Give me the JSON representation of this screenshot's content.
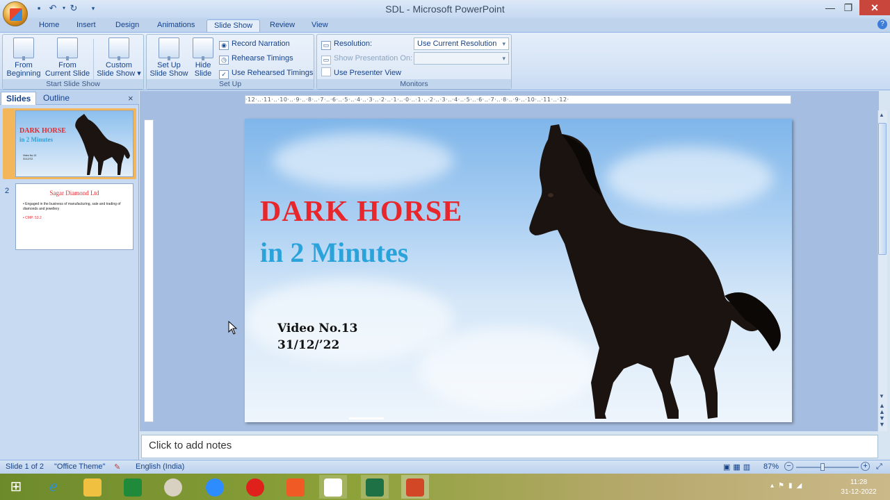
{
  "window": {
    "title": "SDL - Microsoft PowerPoint"
  },
  "qat": {
    "save": "save-icon",
    "undo": "undo-icon",
    "redo": "redo-icon"
  },
  "tabs": [
    "Home",
    "Insert",
    "Design",
    "Animations",
    "Slide Show",
    "Review",
    "View"
  ],
  "active_tab": "Slide Show",
  "ribbon": {
    "start_group": {
      "label": "Start Slide Show",
      "from_beginning": [
        "From",
        "Beginning"
      ],
      "from_current": [
        "From",
        "Current Slide"
      ],
      "custom": [
        "Custom",
        "Slide Show"
      ]
    },
    "setup_group": {
      "label": "Set Up",
      "setup_show": [
        "Set Up",
        "Slide Show"
      ],
      "hide_slide": [
        "Hide",
        "Slide"
      ],
      "record_narration": "Record Narration",
      "rehearse_timings": "Rehearse Timings",
      "use_rehearsed": "Use Rehearsed Timings",
      "use_rehearsed_checked": true
    },
    "monitors_group": {
      "label": "Monitors",
      "resolution_label": "Resolution:",
      "resolution_value": "Use Current Resolution",
      "show_on_label": "Show Presentation On:",
      "show_on_value": "",
      "presenter_view": "Use Presenter View",
      "presenter_view_checked": false
    }
  },
  "left_pane": {
    "tabs": [
      "Slides",
      "Outline"
    ],
    "active": "Slides",
    "close": "×",
    "thumbs": [
      {
        "num": "1",
        "title": "DARK HORSE",
        "subtitle": "in 2 Minutes",
        "small": [
          "Video No.13",
          "31/12/'22"
        ]
      },
      {
        "num": "2",
        "title": "Sagar Diamond Ltd",
        "bullets": [
          "Engaged in the business of manufacturing, sale and trading of diamonds and jewellery",
          "CMP: 53.2"
        ]
      }
    ]
  },
  "ruler_text": "·12·‥·11·‥·10·‥·9·‥·8·‥·7·‥·6·‥·5·‥·4·‥·3·‥·2·‥·1·‥·0·‥·1·‥·2·‥·3·‥·4·‥·5·‥·6·‥·7·‥·8·‥·9·‥·10·‥·11·‥·12·",
  "slide": {
    "title": "DARK HORSE",
    "subtitle": "in 2 Minutes",
    "video_no": "Video No.13",
    "date": "31/12/’22"
  },
  "notes_placeholder": "Click to add notes",
  "status": {
    "slide_of": "Slide 1 of 2",
    "theme": "\"Office Theme\"",
    "language": "English (India)",
    "zoom": "87%"
  },
  "taskbar": {
    "time": "11:28",
    "date": "31-12-2022",
    "icons": [
      "windows-start-icon",
      "internet-explorer-icon",
      "file-explorer-icon",
      "store-icon",
      "paint-icon",
      "zoom-icon",
      "opera-icon",
      "brave-icon",
      "notepad-icon",
      "excel-icon",
      "powerpoint-icon"
    ]
  },
  "colors": {
    "title_red": "#e8272c",
    "subtitle_blue": "#2aa3db",
    "ribbon_blue": "#15428b"
  }
}
